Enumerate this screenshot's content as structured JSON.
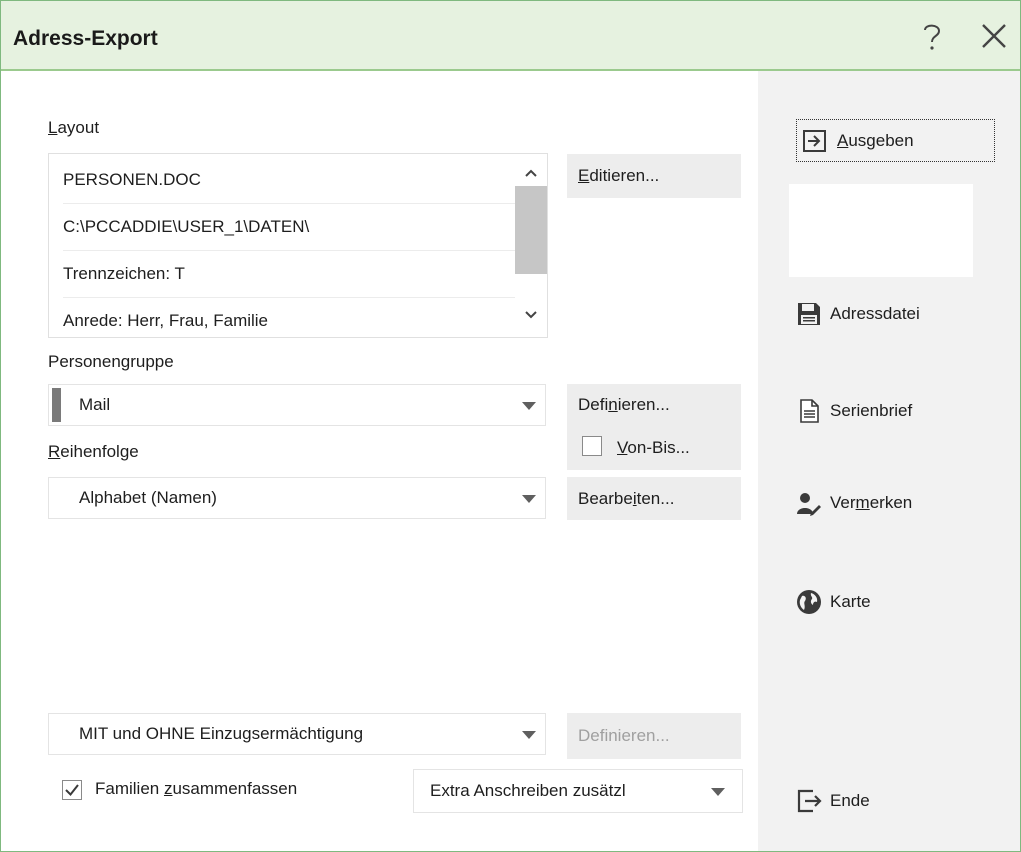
{
  "window": {
    "title": "Adress-Export"
  },
  "layout": {
    "label_first": "L",
    "label_rest": "ayout",
    "items": [
      "PERSONEN.DOC",
      "C:\\PCCADDIE\\USER_1\\DATEN\\",
      "Trennzeichen: T",
      "Anrede: Herr, Frau, Familie"
    ],
    "edit_first": "E",
    "edit_rest": "ditieren..."
  },
  "personengruppe": {
    "label": "Personengruppe",
    "value": "Mail",
    "define_a": "Defi",
    "define_u": "n",
    "define_b": "ieren...",
    "vonbis_u": "V",
    "vonbis_rest": "on-Bis...",
    "vonbis_checked": false
  },
  "reihenfolge": {
    "label_first": "R",
    "label_rest": "eihenfolge",
    "value": "Alphabet (Namen)",
    "edit_a": "Bearbe",
    "edit_u": "i",
    "edit_b": "ten..."
  },
  "einzug": {
    "value": "MIT und OHNE Einzugsermächtigung",
    "define_label": "Definieren..."
  },
  "familien": {
    "checked": true,
    "label_a": "Familien ",
    "label_u": "z",
    "label_b": "usammenfassen",
    "extra_value": "Extra Anschreiben zusätzl"
  },
  "side": {
    "ausgeben_u": "A",
    "ausgeben_rest": "usgeben",
    "adressdatei": "Adressdatei",
    "serienbrief": "Serienbrief",
    "vermerken_a": "Ver",
    "vermerken_u": "m",
    "vermerken_b": "erken",
    "karte": "Karte",
    "ende": "Ende"
  },
  "icons": {
    "help": "help-icon",
    "close": "close-icon",
    "ausgeben": "output-arrow-icon",
    "adressdatei": "save-icon",
    "serienbrief": "document-icon",
    "vermerken": "person-edit-icon",
    "karte": "globe-icon",
    "ende": "exit-icon"
  },
  "colors": {
    "titlebar_bg": "#e6f2e0",
    "titlebar_border": "#9bca8e",
    "side_bg": "#f2f2f2",
    "button_bg": "#ededed",
    "disabled_text": "#a0a0a0"
  }
}
